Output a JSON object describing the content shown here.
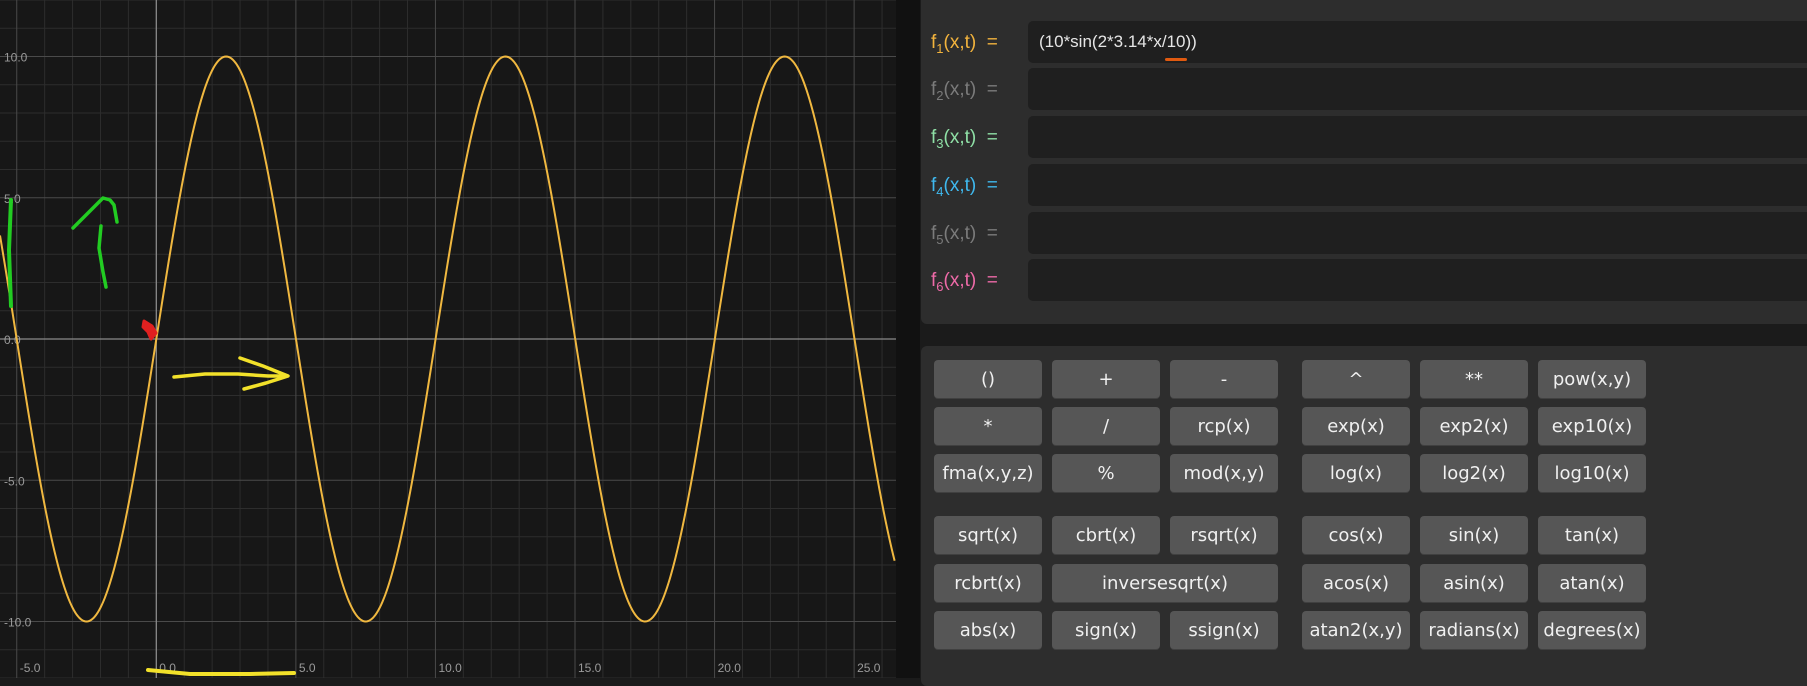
{
  "graph": {
    "x_ticks": [
      "-5.0",
      "0.0",
      "5.0",
      "10.0",
      "15.0",
      "20.0",
      "25.0"
    ],
    "y_ticks": [
      "10.0",
      "5.0",
      "0.0",
      "-5.0",
      "-10.0"
    ],
    "curve_color": "#f0b840",
    "annotation_colors": {
      "arrow_up": "#22cc22",
      "arrow_right": "#f2e12a",
      "marker": "#e02020",
      "underline": "#f2e12a"
    }
  },
  "chart_data": {
    "type": "line",
    "title": "",
    "xlabel": "",
    "ylabel": "",
    "xlim": [
      -5.6,
      26.5
    ],
    "ylim": [
      -12.0,
      12.0
    ],
    "grid": true,
    "series": [
      {
        "function": "10*sin(2*3.14*x/10)",
        "color": "#f0b840",
        "x_range": [
          -5.6,
          26.5
        ]
      }
    ]
  },
  "functions": [
    {
      "name": "f",
      "index": "1",
      "args": "(x,t)",
      "eq": "=",
      "color": "#f2b33d",
      "expression": "(10*sin(2*3.14*x/10))"
    },
    {
      "name": "f",
      "index": "2",
      "args": "(x,t)",
      "eq": "=",
      "color": "#7b7b7b",
      "expression": ""
    },
    {
      "name": "f",
      "index": "3",
      "args": "(x,t)",
      "eq": "=",
      "color": "#8fe0a6",
      "expression": ""
    },
    {
      "name": "f",
      "index": "4",
      "args": "(x,t)",
      "eq": "=",
      "color": "#3fb9ef",
      "expression": ""
    },
    {
      "name": "f",
      "index": "5",
      "args": "(x,t)",
      "eq": "=",
      "color": "#7b7b7b",
      "expression": ""
    },
    {
      "name": "f",
      "index": "6",
      "args": "(x,t)",
      "eq": "=",
      "color": "#ee6aa8",
      "expression": ""
    }
  ],
  "keypad": {
    "keys": [
      "()",
      "+",
      "-",
      "^",
      "**",
      "pow(x,y)",
      "*",
      "/",
      "rcp(x)",
      "exp(x)",
      "exp2(x)",
      "exp10(x)",
      "fma(x,y,z)",
      "%",
      "mod(x,y)",
      "log(x)",
      "log2(x)",
      "log10(x)",
      "sqrt(x)",
      "cbrt(x)",
      "rsqrt(x)",
      "cos(x)",
      "sin(x)",
      "tan(x)",
      "rcbrt(x)",
      "inversesqrt(x)",
      "acos(x)",
      "asin(x)",
      "atan(x)",
      "abs(x)",
      "sign(x)",
      "ssign(x)",
      "atan2(x,y)",
      "radians(x)",
      "degrees(x)"
    ]
  }
}
